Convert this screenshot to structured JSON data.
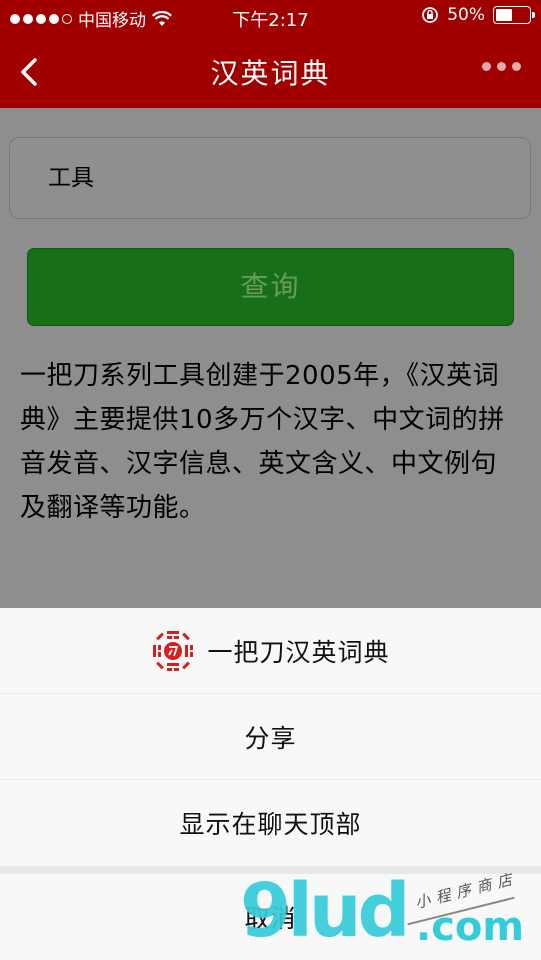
{
  "status_bar": {
    "carrier": "中国移动",
    "time": "下午2:17",
    "battery": "50%",
    "battery_level": 0.5
  },
  "nav": {
    "title": "汉英词典",
    "back_icon": "chevron-left-icon",
    "more_icon": "more-dots-icon"
  },
  "search": {
    "value": "工具"
  },
  "query_button": {
    "label": "查询",
    "color": "#176f17"
  },
  "intro": {
    "text": "一把刀系列工具创建于2005年，《汉英词典》主要提供10多万个汉字、中文词的拼音发音、汉字信息、英文含义、中文例句及翻译等功能。"
  },
  "action_sheet": {
    "brand_label": "一把刀汉英词典",
    "brand_icon": "bagua-logo-icon",
    "share_label": "分享",
    "pin_label": "显示在聊天顶部",
    "cancel_label": "取消"
  },
  "watermark": {
    "main": "9lud",
    "suffix": ".com",
    "sub": "小程序商店"
  },
  "colors": {
    "header_bg": "#a10000",
    "overlay_bg": "#8e8e8e",
    "sheet_bg": "#f8f8f8",
    "watermark": "#34ccd9"
  }
}
